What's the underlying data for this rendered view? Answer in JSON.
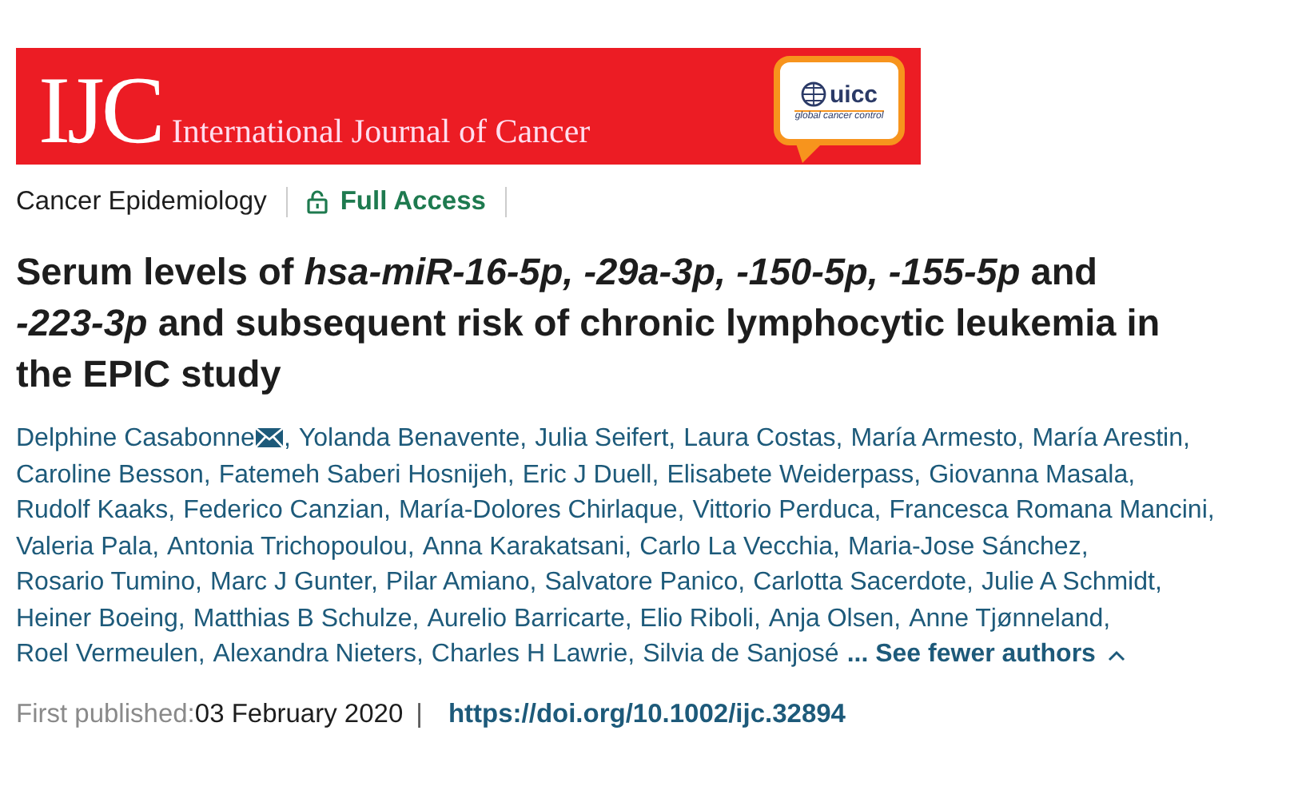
{
  "banner": {
    "logo_letters": "IJC",
    "journal_name": "International Journal of Cancer",
    "partner_logo": {
      "name": "uicc",
      "tagline": "global cancer control"
    }
  },
  "meta": {
    "section": "Cancer Epidemiology",
    "access": "Full Access"
  },
  "title": "Serum levels of *hsa-miR-16-5p, -29a-3p, -150-5p, -155-5p* and *-223-3p* and subsequent risk of chronic lymphocytic leukemia in the EPIC study",
  "authors": [
    {
      "name": "Delphine Casabonne",
      "email": true,
      "after": ","
    },
    {
      "name": "Yolanda Benavente,",
      "email": false
    },
    {
      "name": "Julia Seifert,",
      "email": false
    },
    {
      "name": "Laura Costas,",
      "email": false
    },
    {
      "name": "María Armesto,",
      "email": false
    },
    {
      "name": "María Arestin,",
      "email": false
    },
    {
      "name": "Caroline Besson,",
      "email": false
    },
    {
      "name": "Fatemeh Saberi Hosnijeh,",
      "email": false
    },
    {
      "name": "Eric J Duell,",
      "email": false
    },
    {
      "name": "Elisabete Weiderpass,",
      "email": false
    },
    {
      "name": "Giovanna Masala,",
      "email": false
    },
    {
      "name": "Rudolf Kaaks,",
      "email": false
    },
    {
      "name": "Federico Canzian,",
      "email": false
    },
    {
      "name": "María-Dolores Chirlaque,",
      "email": false
    },
    {
      "name": "Vittorio Perduca,",
      "email": false
    },
    {
      "name": "Francesca Romana Mancini,",
      "email": false
    },
    {
      "name": "Valeria Pala,",
      "email": false
    },
    {
      "name": "Antonia Trichopoulou,",
      "email": false
    },
    {
      "name": "Anna Karakatsani,",
      "email": false
    },
    {
      "name": "Carlo La Vecchia,",
      "email": false
    },
    {
      "name": "Maria-Jose Sánchez,",
      "email": false
    },
    {
      "name": "Rosario Tumino,",
      "email": false
    },
    {
      "name": "Marc J Gunter,",
      "email": false
    },
    {
      "name": "Pilar Amiano,",
      "email": false
    },
    {
      "name": "Salvatore Panico,",
      "email": false
    },
    {
      "name": "Carlotta Sacerdote,",
      "email": false
    },
    {
      "name": "Julie A Schmidt,",
      "email": false
    },
    {
      "name": "Heiner Boeing,",
      "email": false
    },
    {
      "name": "Matthias B Schulze,",
      "email": false
    },
    {
      "name": "Aurelio Barricarte,",
      "email": false
    },
    {
      "name": "Elio Riboli,",
      "email": false
    },
    {
      "name": "Anja Olsen,",
      "email": false
    },
    {
      "name": "Anne Tjønneland,",
      "email": false
    },
    {
      "name": "Roel Vermeulen,",
      "email": false
    },
    {
      "name": "Alexandra Nieters,",
      "email": false
    },
    {
      "name": "Charles H Lawrie,",
      "email": false
    },
    {
      "name": "Silvia de Sanjosé",
      "email": false
    }
  ],
  "authors_toggle": {
    "label": "... See fewer authors",
    "expanded": true
  },
  "publication": {
    "label": "First published:",
    "date": "03 February 2020",
    "separator": "|",
    "doi": "https://doi.org/10.1002/ijc.32894"
  }
}
